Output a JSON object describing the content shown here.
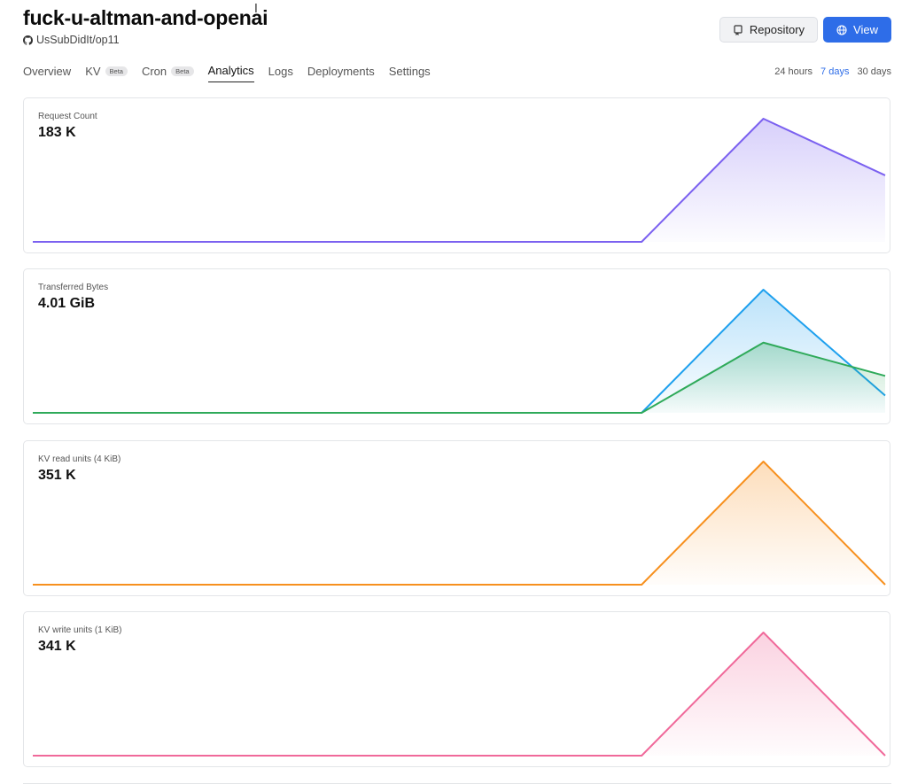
{
  "header": {
    "title": "fuck-u-altman-and-openai",
    "repo": "UsSubDidIt/op11",
    "repository_label": "Repository",
    "view_label": "View"
  },
  "tabs": [
    {
      "label": "Overview",
      "badge": null
    },
    {
      "label": "KV",
      "badge": "Beta"
    },
    {
      "label": "Cron",
      "badge": "Beta"
    },
    {
      "label": "Analytics",
      "badge": null,
      "active": true
    },
    {
      "label": "Logs",
      "badge": null
    },
    {
      "label": "Deployments",
      "badge": null
    },
    {
      "label": "Settings",
      "badge": null
    }
  ],
  "ranges": [
    {
      "label": "24 hours"
    },
    {
      "label": "7 days",
      "active": true
    },
    {
      "label": "30 days"
    }
  ],
  "chart_data": [
    {
      "type": "area",
      "title": "Request Count",
      "total": "183 K",
      "x": [
        0,
        1,
        2,
        3,
        4,
        5,
        6,
        7
      ],
      "series": [
        {
          "color": "#7b61f0",
          "values": [
            0,
            0,
            0,
            0,
            0,
            0,
            1.0,
            0.54
          ]
        }
      ]
    },
    {
      "type": "area",
      "title": "Transferred Bytes",
      "total": "4.01 GiB",
      "x": [
        0,
        1,
        2,
        3,
        4,
        5,
        6,
        7
      ],
      "series": [
        {
          "color": "#1ea0ee",
          "values": [
            0,
            0,
            0,
            0,
            0,
            0,
            1.0,
            0.14
          ]
        },
        {
          "color": "#2faa5a",
          "values": [
            0,
            0,
            0,
            0,
            0,
            0,
            0.57,
            0.3
          ]
        }
      ]
    },
    {
      "type": "area",
      "title": "KV read units (4 KiB)",
      "total": "351 K",
      "x": [
        0,
        1,
        2,
        3,
        4,
        5,
        6,
        7
      ],
      "series": [
        {
          "color": "#f7901e",
          "values": [
            0,
            0,
            0,
            0,
            0,
            0,
            1.0,
            0
          ]
        }
      ]
    },
    {
      "type": "area",
      "title": "KV write units (1 KiB)",
      "total": "341 K",
      "x": [
        0,
        1,
        2,
        3,
        4,
        5,
        6,
        7
      ],
      "series": [
        {
          "color": "#f0699a",
          "values": [
            0,
            0,
            0,
            0,
            0,
            0,
            1.0,
            0
          ]
        }
      ]
    }
  ]
}
